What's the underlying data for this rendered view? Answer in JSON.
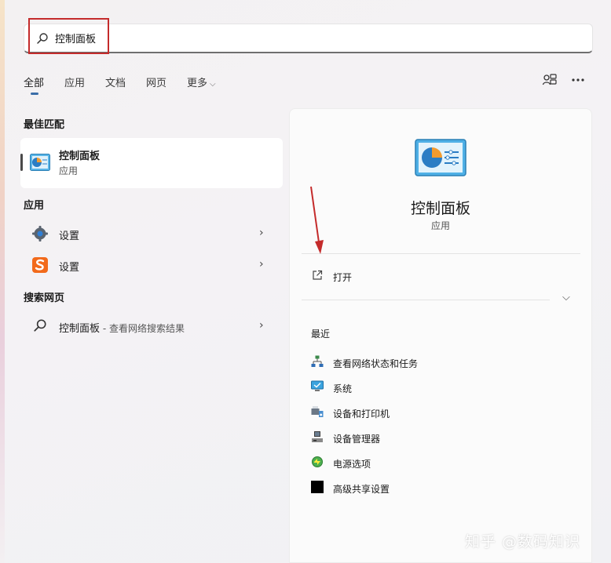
{
  "search": {
    "query": "控制面板"
  },
  "tabs": [
    {
      "label": "全部"
    },
    {
      "label": "应用"
    },
    {
      "label": "文档"
    },
    {
      "label": "网页"
    },
    {
      "label": "更多"
    }
  ],
  "sections": {
    "best_match": "最佳匹配",
    "apps": "应用",
    "web": "搜索网页"
  },
  "best_match": {
    "title": "控制面板",
    "subtitle": "应用"
  },
  "apps": [
    {
      "label": "设置"
    },
    {
      "label": "设置"
    }
  ],
  "web_result": {
    "title": "控制面板",
    "separator": " - ",
    "subtitle": "查看网络搜索结果"
  },
  "detail": {
    "title": "控制面板",
    "subtitle": "应用",
    "open_label": "打开",
    "recent_heading": "最近",
    "recent": [
      {
        "label": "查看网络状态和任务",
        "icon": "network-icon"
      },
      {
        "label": "系统",
        "icon": "system-monitor-icon"
      },
      {
        "label": "设备和打印机",
        "icon": "printer-icon"
      },
      {
        "label": "设备管理器",
        "icon": "device-manager-icon"
      },
      {
        "label": "电源选项",
        "icon": "power-options-icon"
      },
      {
        "label": "高级共享设置",
        "icon": "black-square-icon"
      }
    ]
  },
  "watermark": "知乎 @数码知识",
  "colors": {
    "accent": "#3b6ea8",
    "highlight_box": "#c42b2b",
    "arrow": "#c42b2b"
  }
}
